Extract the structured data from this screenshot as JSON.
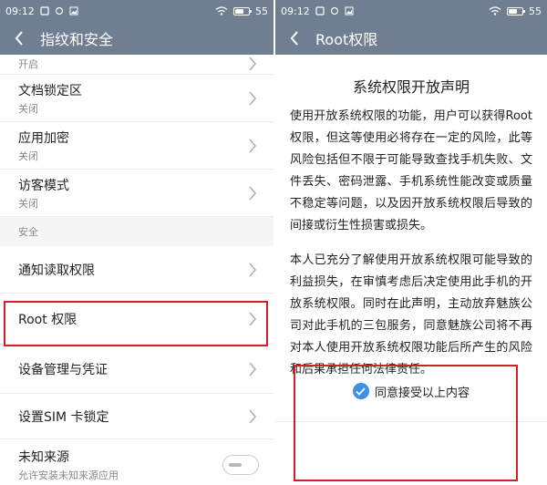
{
  "left": {
    "status": {
      "time": "09:12",
      "battery": "55"
    },
    "title": "指纹和安全",
    "items_top": [
      {
        "label": "",
        "sub": "开启"
      },
      {
        "label": "文档锁定区",
        "sub": "关闭"
      },
      {
        "label": "应用加密",
        "sub": "关闭"
      },
      {
        "label": "访客模式",
        "sub": "关闭"
      }
    ],
    "section_header": "安全",
    "items_security": [
      {
        "label": "通知读取权限"
      },
      {
        "label": "Root 权限"
      },
      {
        "label": "设备管理与凭证"
      },
      {
        "label": "设置SIM 卡锁定"
      },
      {
        "label": "未知来源",
        "sub": "允许安装未知来源应用"
      }
    ]
  },
  "right": {
    "status": {
      "time": "09:12",
      "battery": "55"
    },
    "title": "Root权限",
    "heading": "系统权限开放声明",
    "paragraph1": "使用开放系统权限的功能，用户可以获得Root权限，但这等使用必将存在一定的风险，此等风险包括但不限于可能导致查找手机失败、文件丢失、密码泄露、手机系统性能改变或质量不稳定等问题，以及因开放系统权限后导致的间接或衍生性损害或损失。",
    "paragraph2": "本人已充分了解使用开放系统权限可能导致的利益损失，在审慎考虑后决定使用此手机的开放系统权限。同时在此声明，主动放弃魅族公司对此手机的三包服务，同意魅族公司将不再对本人使用开放系统权限功能后所产生的风险和后果承担任何法律责任。",
    "agree_label": "同意接受以上内容"
  },
  "colors": {
    "titlebar": "#6f7f91",
    "accent": "#3f8fe3",
    "highlight": "#d0202a"
  },
  "icons": [
    "back-arrow-icon",
    "chevron-right-icon",
    "check-icon",
    "wifi-icon",
    "battery-icon"
  ]
}
